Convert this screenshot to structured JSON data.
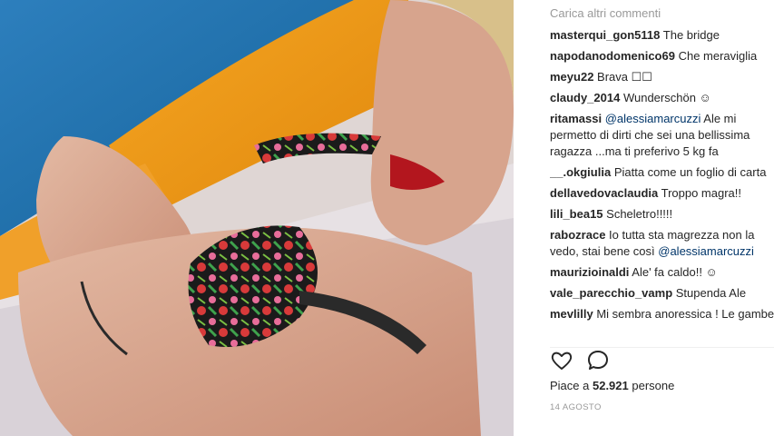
{
  "photo": {
    "description_icon": "photo-icon"
  },
  "comments": {
    "load_more": "Carica altri commenti",
    "items": [
      {
        "user": "masterqui_gon5118",
        "text": " The bridge"
      },
      {
        "user": "napodanodomenico69",
        "text": " Che meraviglia"
      },
      {
        "user": "meyu22",
        "text": " Brava ☐☐"
      },
      {
        "user": "claudy_2014",
        "text": " Wunderschön ☺"
      },
      {
        "user": "ritamassi",
        "mention": " @alessiamarcuzzi",
        "text": " Ale mi permetto di dirti che sei una bellissima ragazza ...ma ti preferivo 5 kg fa"
      },
      {
        "user": "__.okgiulia",
        "text": " Piatta come un foglio di carta"
      },
      {
        "user": "dellavedovaclaudia",
        "text": " Troppo magra!!"
      },
      {
        "user": "lili_bea15",
        "text": " Scheletro!!!!!"
      },
      {
        "user": "rabozrace",
        "text": " Io tutta sta magrezza non la vedo, stai bene così ",
        "mention_end": "@alessiamarcuzzi"
      },
      {
        "user": "maurizioinaldi",
        "text": " Ale' fa caldo!! ☺"
      },
      {
        "user": "vale_parecchio_vamp",
        "text": " Stupenda Ale"
      },
      {
        "user": "mevlilly",
        "text": " Mi sembra anoressica ! Le gambe"
      }
    ]
  },
  "actions": {
    "like_icon": "heart-icon",
    "comment_icon": "speech-bubble-icon"
  },
  "likes": {
    "prefix": "Piace a ",
    "count": "52.921",
    "suffix": " persone"
  },
  "date": "14 agosto"
}
